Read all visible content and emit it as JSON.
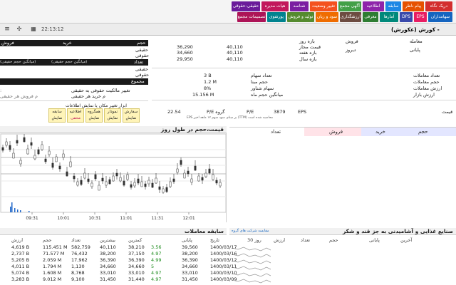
{
  "tabs": [
    {
      "label": "دریک نگاه",
      "color": "#d32f2f"
    },
    {
      "label": "پیام ناظر",
      "color": "#e65100"
    },
    {
      "label": "سابقه",
      "color": "#1e88e5"
    },
    {
      "label": "اطلاعیه",
      "color": "#8e24aa"
    },
    {
      "label": "آگهی مجمع",
      "color": "#43a047"
    },
    {
      "label": "تغییر وضعیت",
      "color": "#f4511e"
    },
    {
      "label": "شناسه",
      "color": "#7b1fa2"
    },
    {
      "label": "هیات مدیره",
      "color": "#c2185b"
    },
    {
      "label": "حقیقی-حقوقی",
      "color": "#6a1b9a"
    }
  ],
  "tabs_row2": [
    {
      "label": "سهامداران",
      "color": "#1565c0"
    },
    {
      "label": "EPS",
      "color": "#e91e63"
    },
    {
      "label": "DPS",
      "color": "#3949ab"
    },
    {
      "label": "آمارها",
      "color": "#00897b"
    },
    {
      "label": "معرفی",
      "color": "#2e7d32"
    },
    {
      "label": "ارزشگذاری",
      "color": "#6d4c41"
    },
    {
      "label": "سود و زیان",
      "color": "#ef6c00"
    },
    {
      "label": "تولید و فروش",
      "color": "#558b2f"
    },
    {
      "label": "پورتفوی",
      "color": "#00838f"
    },
    {
      "label": "تصمیمات مجمع",
      "color": "#ad1457"
    }
  ],
  "toolbar": {
    "time": "22:13:12",
    "title": "کورش (عکورش) -"
  },
  "info": {
    "trade_label": "معامله",
    "trade_value": "فروش",
    "status_label": "پایانی",
    "status_value": "دیروز",
    "range_day": "بازه روز",
    "allowed_price": "قیمت مجاز",
    "range_week": "بازه هفته",
    "range_year": "بازه سال",
    "allowed_low": "36,290",
    "allowed_high": "40,110",
    "week_low": "34,660",
    "week_high": "40,110",
    "year_low": "29,950",
    "year_high": "40,110",
    "trades_count": "تعداد معاملات",
    "trades_volume": "حجم معاملات",
    "trades_value": "ارزش معاملات",
    "market_value": "ارزش بازار",
    "shares_count_label": "تعداد سهام",
    "shares_count": "3 B",
    "base_volume_label": "حجم مبنا",
    "base_volume": "1.2 M",
    "float_label": "سهام شناور",
    "float": "8%",
    "avg_month_label": "میانگین حجم ماه",
    "avg_month": "15.156 M",
    "eps_label": "EPS",
    "eps": "3879",
    "pe_label": "P/E",
    "pe_value": "",
    "pe_group_label": "P/E گروه",
    "pe_group": "22.54",
    "eps_note": "EPS بر مبنای سود سهم ۱۲ ماهه اخیر (TTM) محاسبه شده است",
    "price_label": "قیمت"
  },
  "left_panel": {
    "volume": "حجم",
    "buy": "خرید",
    "sell": "فروش",
    "real": "حقیقی",
    "legal": "حقوقی",
    "count": "تعداد",
    "avg_real_buy": "(میانگین حجم حقیقی)",
    "avg_real_sell": "(میانگین حجم حقیقی)",
    "total": "مجموع",
    "real_change": "تغییر مالکیت حقوقی به حقیقی",
    "real_power": "قدرت خریدار/فروشنده حقیقی",
    "per_real": "م خرید هر حقیقی",
    "per_real_sell": "م فروش هر حقیقی",
    "tools_note": "ابزار تغییر مکان یا نمایش اطلاعات",
    "buttons": [
      {
        "top": "سفارش",
        "bottom": "نمایش"
      },
      {
        "top": "نمودار",
        "bottom": "نمایش"
      },
      {
        "top": "همگروه",
        "bottom": "نمایش"
      },
      {
        "top": "اطلاعیه",
        "bottom": "محفی"
      },
      {
        "top": "سابقه",
        "bottom": "نمایش"
      }
    ]
  },
  "orderbook": {
    "headers": [
      "حجم",
      "خرید",
      "فروش",
      "تعداد"
    ],
    "colors": {
      "buy": "#e3e6ff",
      "sell": "#ffe3e8"
    }
  },
  "chart": {
    "title": "قیمت،حجم در طول روز",
    "xticks": [
      "09:31",
      "10:01",
      "10:31",
      "11:01",
      "11:31",
      "12:01"
    ]
  },
  "history": {
    "title": "سابقه معاملات",
    "headers": [
      "تاریخ",
      "پایانی",
      "",
      "کمترین",
      "بیشترین",
      "تعداد",
      "حجم",
      "ارزش"
    ],
    "rows": [
      [
        "1400/03/17",
        "39,560",
        "3.56",
        "38,210",
        "40,110",
        "582,759",
        "115.451 M",
        "4,619 B"
      ],
      [
        "1400/03/16",
        "38,200",
        "4.97",
        "37,150",
        "38,200",
        "76,432",
        "71.577 M",
        "2,737 B"
      ],
      [
        "1400/03/12",
        "36,390",
        "4.99",
        "36,390",
        "36,390",
        "17,962",
        "2.059 M",
        "5,205 B"
      ],
      [
        "1400/03/11",
        "34,660",
        "5",
        "34,660",
        "34,660",
        "1,130",
        "1.794 M",
        "4,011 B"
      ],
      [
        "1400/03/10",
        "33,010",
        "4.97",
        "33,010",
        "33,010",
        "8,768",
        "1.608 M",
        "5,074 B"
      ],
      [
        "1400/03/09",
        "31,450",
        "4.97",
        "31,440",
        "31,450",
        "9,100",
        "9.012 M",
        "3,283 B"
      ]
    ]
  },
  "group": {
    "link": "مقایسه شرکت های گروه",
    "title": "صنایع غذایی و آشامیدنی به جز قند و شکر",
    "headers": [
      "آخرین",
      "پایانی",
      "حجم",
      "تعداد",
      "ارزش",
      "30 روز"
    ]
  }
}
